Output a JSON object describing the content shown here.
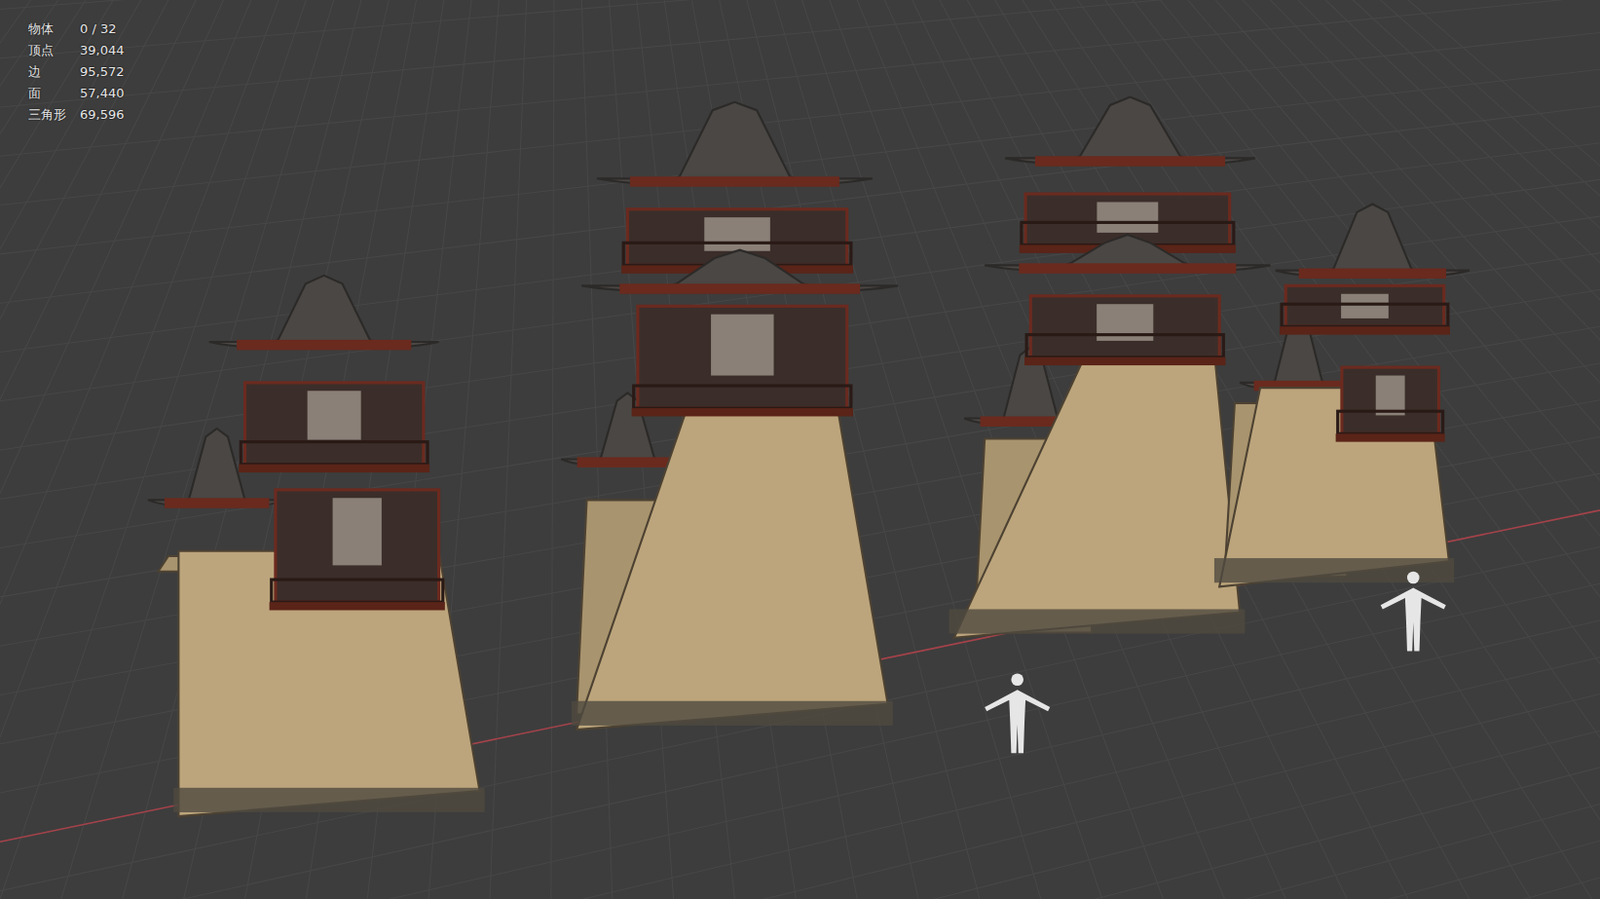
{
  "viewport": {
    "stats": [
      {
        "label": "物体",
        "value": "0 / 32"
      },
      {
        "label": "顶点",
        "value": "39,044"
      },
      {
        "label": "边",
        "value": "95,572"
      },
      {
        "label": "面",
        "value": "57,440"
      },
      {
        "label": "三角形",
        "value": "69,596"
      }
    ]
  }
}
